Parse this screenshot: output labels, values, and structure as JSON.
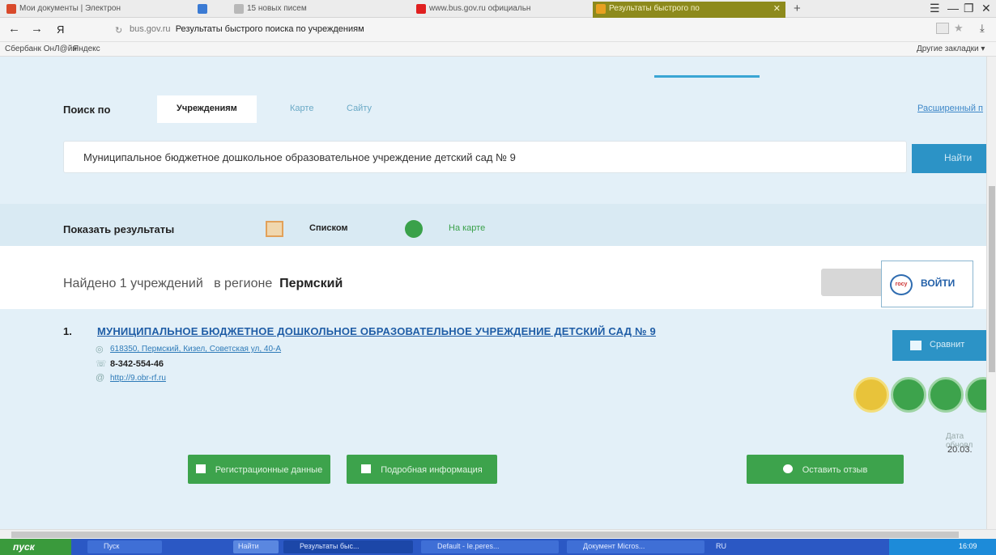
{
  "browser": {
    "tabs": [
      {
        "label": "Мои документы | Электрон",
        "icon_color": "#d94a2b"
      },
      {
        "label": "",
        "icon_color": "#3b7bd4"
      },
      {
        "label": "15 новых писем",
        "icon_color": "#b8b8b8"
      },
      {
        "label": "www.bus.gov.ru официальн",
        "icon_color": "#e02020"
      },
      {
        "label": "Результаты быстрого по",
        "icon_color": "#e8a020"
      }
    ],
    "new_tab": "+",
    "url_host": "bus.gov.ru",
    "url_title": "Результаты быстрого поиска по учреждениям",
    "bookmarks": [
      "Сбербанк ОнЛ@йн",
      "Яндекс"
    ],
    "other_bookmarks": "Другие закладки ▾"
  },
  "search": {
    "label": "Поиск по",
    "tabs": [
      "Учреждениям",
      "Карте",
      "Сайту"
    ],
    "advanced_link": "Расширенный п",
    "query": "Муниципальное бюджетное дошкольное образовательное учреждение детский сад № 9",
    "find_button": "Найти"
  },
  "results_view": {
    "label": "Показать результаты",
    "list_label": "Списком",
    "map_label": "На карте"
  },
  "found": {
    "prefix": "Найдено 1 учреждений",
    "region_label": "в регионе",
    "region": "Пермский"
  },
  "login_button": "ВОЙТИ",
  "result": {
    "number": "1.",
    "title": "МУНИЦИПАЛЬНОЕ БЮДЖЕТНОЕ ДОШКОЛЬНОЕ ОБРАЗОВАТЕЛЬНОЕ УЧРЕЖДЕНИЕ ДЕТСКИЙ САД № 9",
    "address": "618350, Пермский, Кизел, Советская ул, 40-А",
    "phone": "8-342-554-46",
    "site": "http://9.obr-rf.ru",
    "compare_button": "Сравнит",
    "update_label": "Дата обновл",
    "update_date": "20.03.",
    "circle_colors": [
      "#e8c33a",
      "#3da34c",
      "#3da34c",
      "#3da34c"
    ]
  },
  "actions": {
    "registration": "Регистрационные данные",
    "details": "Подробная информация",
    "feedback": "Оставить отзыв"
  },
  "taskbar": {
    "start": "пуск",
    "items": [
      "Пуск",
      "Найти",
      "Результаты быс...",
      "Default - Ie.peres...",
      "Документ Micros..."
    ],
    "lang": "RU",
    "time": "16:09"
  }
}
